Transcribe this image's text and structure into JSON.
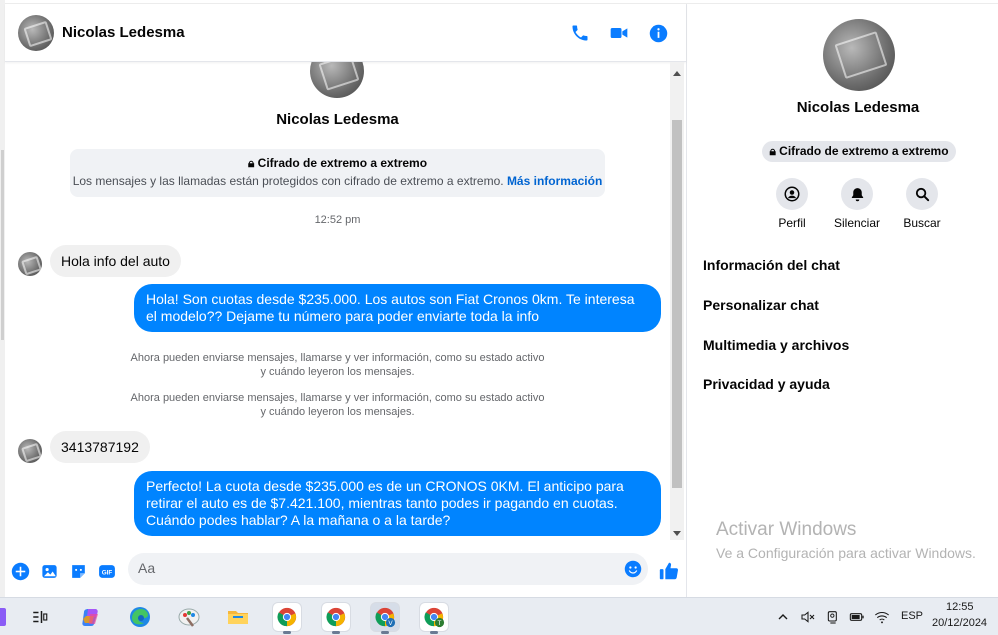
{
  "chat": {
    "contact_name": "Nicolas Ledesma",
    "profile_name": "Nicolas Ledesma",
    "e2e_title": "Cifrado de extremo a extremo",
    "e2e_text": "Los mensajes y las llamadas están protegidos con cifrado de extremo a extremo.",
    "e2e_link": "Más información",
    "timestamp": "12:52 pm",
    "messages": [
      {
        "direction": "in",
        "text": "Hola info del auto"
      },
      {
        "direction": "out",
        "text": "Hola! Son cuotas desde $235.000. Los autos son Fiat Cronos 0km. Te interesa el modelo?? Dejame tu número para poder enviarte toda la info"
      },
      {
        "direction": "in",
        "text": "3413787192"
      },
      {
        "direction": "out",
        "text": "Perfecto! La cuota desde $235.000 es de un CRONOS 0KM. El anticipo para retirar el auto es de $7.421.100, mientras tanto podes ir pagando en cuotas. Cuándo podes hablar? A la mañana o a la tarde?"
      }
    ],
    "system_1_line1": "Ahora pueden enviarse mensajes, llamarse y ver información, como su estado activo",
    "system_1_line2": "y cuándo leyeron los mensajes.",
    "system_2_line1": "Ahora pueden enviarse mensajes, llamarse y ver información, como su estado activo",
    "system_2_line2": "y cuándo leyeron los mensajes.",
    "composer_placeholder": "Aa"
  },
  "info_panel": {
    "name": "Nicolas Ledesma",
    "e2e_badge": "Cifrado de extremo a extremo",
    "actions": [
      {
        "label": "Perfil",
        "icon": "user-icon"
      },
      {
        "label": "Silenciar",
        "icon": "bell-icon"
      },
      {
        "label": "Buscar",
        "icon": "search-icon"
      }
    ],
    "menu": [
      "Información del chat",
      "Personalizar chat",
      "Multimedia y archivos",
      "Privacidad y ayuda"
    ]
  },
  "watermark": {
    "line1": "Activar Windows",
    "line2": "Ve a Configuración para activar Windows."
  },
  "taskbar": {
    "language": "ESP",
    "time": "12:55",
    "date": "20/12/2024",
    "apps": [
      "task-view-icon",
      "copilot-icon",
      "edge-icon",
      "paint-icon",
      "file-explorer-icon",
      "chrome-icon",
      "chrome-icon",
      "chrome-v-icon",
      "chrome-t-icon"
    ]
  },
  "colors": {
    "accent": "#0084ff",
    "icon_blue": "#0a7cff",
    "incoming_bubble": "#f0f0f0"
  }
}
